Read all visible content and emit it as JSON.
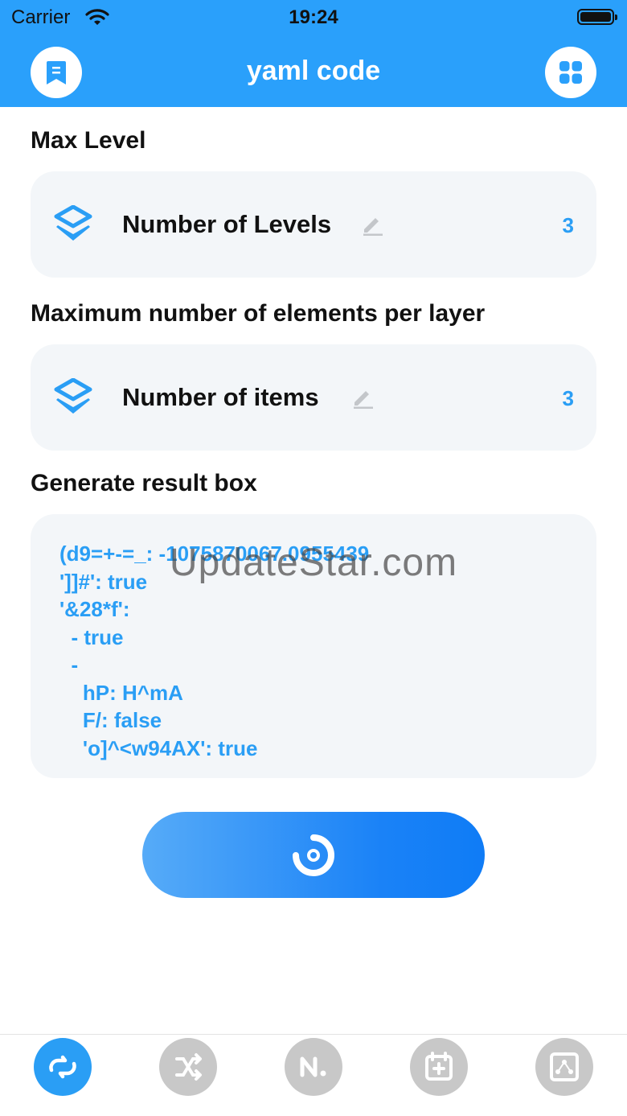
{
  "status_bar": {
    "carrier": "Carrier",
    "time": "19:24"
  },
  "nav": {
    "title": "yaml code",
    "left_icon": "bookmark-icon",
    "right_icon": "grid-icon"
  },
  "sections": {
    "max_level": {
      "title": "Max Level",
      "label": "Number of Levels",
      "value": "3"
    },
    "max_elements": {
      "title": "Maximum number of elements per layer",
      "label": "Number of items",
      "value": "3"
    },
    "result": {
      "title": "Generate result box",
      "text": "(d9=+-=_: -1075870067.0955439\n']]#': true\n'&28*f':\n  - true\n  -\n    hP: H^mA\n    F/: false\n    'o]^<w94AX': true"
    }
  },
  "watermark": "UpdateStar.com",
  "generate_button": {
    "icon": "refresh-ring-icon"
  },
  "tabbar": {
    "tabs": [
      {
        "icon": "convert-icon",
        "active": true
      },
      {
        "icon": "shuffle-icon",
        "active": false
      },
      {
        "icon": "n-logo-icon",
        "active": false
      },
      {
        "icon": "calendar-add-icon",
        "active": false
      },
      {
        "icon": "network-icon",
        "active": false
      }
    ]
  },
  "colors": {
    "accent": "#2aa0fb",
    "value_blue": "#2a9ef5",
    "card_bg": "#f3f6f9",
    "inactive_tab": "#c8c8c8"
  }
}
